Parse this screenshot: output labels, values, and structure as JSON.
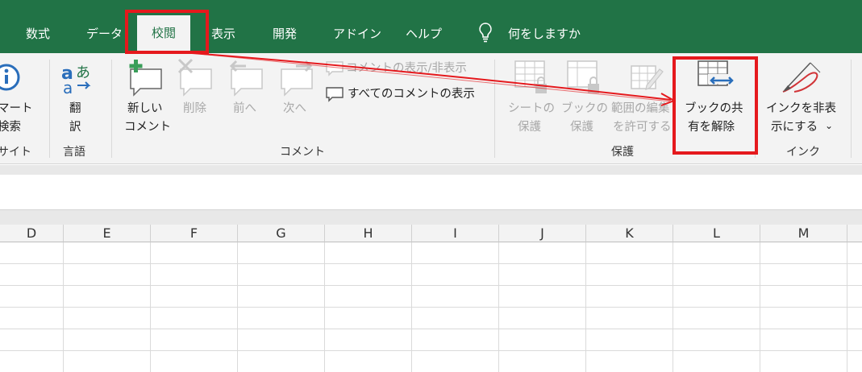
{
  "tabs": [
    {
      "label": "数式"
    },
    {
      "label": "データ"
    },
    {
      "label": "校閲",
      "active": true
    },
    {
      "label": "表示"
    },
    {
      "label": "開発"
    },
    {
      "label": "アドイン"
    },
    {
      "label": "ヘルプ"
    }
  ],
  "tell_me": {
    "icon": "lightbulb-icon",
    "label": "何をしますか"
  },
  "ribbon": {
    "insights": {
      "line1": "マート",
      "line2": "検索",
      "group": "サイト"
    },
    "language": {
      "line1": "翻",
      "line2": "訳",
      "group": "言語"
    },
    "comments": {
      "new_line1": "新しい",
      "new_line2": "コメント",
      "delete": "削除",
      "prev": "前へ",
      "next": "次へ",
      "show_hide": "コメントの表示/非表示",
      "show_all": "すべてのコメントの表示",
      "group": "コメント"
    },
    "protect": {
      "sheet_line1": "シートの",
      "sheet_line2": "保護",
      "book_line1": "ブックの",
      "book_line2": "保護",
      "range_line1": "範囲の編集",
      "range_line2": "を許可する",
      "unshare_line1": "ブックの共",
      "unshare_line2": "有を解除",
      "group": "保護"
    },
    "ink": {
      "line1": "インクを非表",
      "line2": "示にする",
      "chevron": "⌄",
      "group": "インク"
    }
  },
  "columns": [
    "D",
    "E",
    "F",
    "G",
    "H",
    "I",
    "J",
    "K",
    "L",
    "M"
  ],
  "colors": {
    "brand": "#217346",
    "annotation": "#e5191d"
  }
}
